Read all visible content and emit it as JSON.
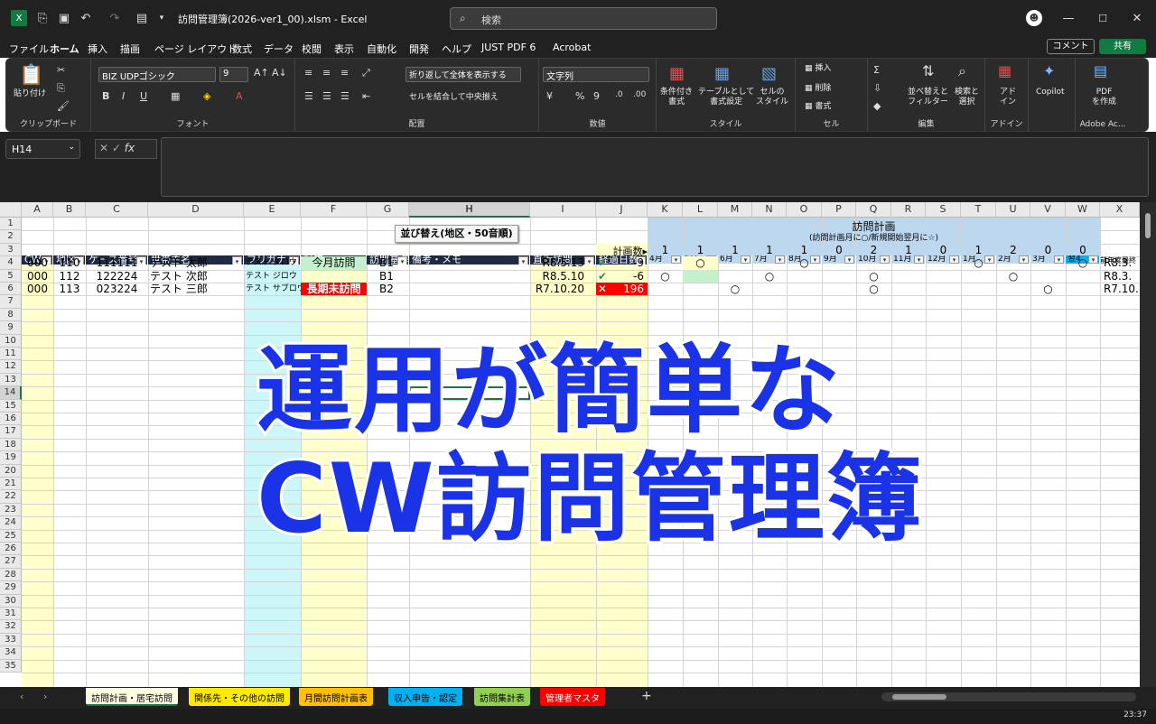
{
  "window": {
    "title": "訪問管理簿(2026-ver1_00).xlsm  -  Excel",
    "search_placeholder": "検索"
  },
  "menu": [
    "ファイル",
    "ホーム",
    "挿入",
    "描画",
    "ページ レイアウト",
    "数式",
    "データ",
    "校閲",
    "表示",
    "自動化",
    "開発",
    "ヘルプ",
    "JUST PDF 6",
    "Acrobat"
  ],
  "menu_active": "ホーム",
  "comment_label": "コメント",
  "share_label": "共有",
  "ribbon": {
    "clipboard": {
      "label": "クリップボード",
      "paste": "貼り付け"
    },
    "font": {
      "label": "フォント",
      "font_name": "BIZ UDPゴシック",
      "font_size": "9"
    },
    "alignment": {
      "label": "配置",
      "wrap": "折り返して全体を表示する",
      "merge": "セルを結合して中央揃え"
    },
    "number": {
      "label": "数値",
      "format": "文字列"
    },
    "styles": {
      "label": "スタイル",
      "cond": "条件付き\n書式",
      "table": "テーブルとして\n書式設定",
      "cell": "セルの\nスタイル"
    },
    "cells": {
      "label": "セル",
      "insert": "挿入",
      "delete": "削除",
      "format": "書式"
    },
    "editing": {
      "label": "編集",
      "sort": "並べ替えと\nフィルター",
      "find": "検索と\n選択"
    },
    "addins": {
      "label": "アドイン",
      "addin": "アド\nイン"
    },
    "copilot": "Copilot",
    "adobe": {
      "label": "Adobe Ac...",
      "pdf": "PDF\nを作成"
    }
  },
  "name_box": "H14",
  "columns": [
    "A",
    "B",
    "C",
    "D",
    "E",
    "F",
    "G",
    "H",
    "I",
    "J",
    "K",
    "L",
    "M",
    "N",
    "O",
    "P",
    "Q",
    "R",
    "S",
    "T",
    "U",
    "V",
    "W",
    "X"
  ],
  "sort_button": "並び替え(地区・50音順)",
  "plan_title": "訪問計画",
  "plan_subtitle": "(訪問計画月に○/新規開始翌月に☆)",
  "plan_count_label": "計画数▸",
  "plan_counts": [
    "1",
    "1",
    "1",
    "1",
    "1",
    "0",
    "2",
    "1",
    "0",
    "1",
    "2",
    "0",
    "0"
  ],
  "headers": [
    "CW",
    "地区",
    "ケース番号",
    "世帯主名",
    "フリガナ",
    "対応",
    "訪問基準",
    "備考・メモ",
    "直近訪問",
    "経過日数",
    "4月",
    "5月",
    "6月",
    "7月",
    "8月",
    "9月",
    "10月",
    "11月",
    "12月",
    "1月",
    "2月",
    "3月",
    "翌4",
    "前年度最終"
  ],
  "rows": [
    {
      "cw": "000",
      "area": "110",
      "case": "111111",
      "name": "テスト 太郎",
      "kana": "テスト タロウ",
      "status": "今月訪問",
      "base": "B1",
      "last": "R8.5.13",
      "mark": "✔",
      "days": "-9",
      "prev": "R8.3."
    },
    {
      "cw": "000",
      "area": "112",
      "case": "122224",
      "name": "テスト 次郎",
      "kana": "テスト ジロウ",
      "status": "",
      "base": "B1",
      "last": "R8.5.10",
      "mark": "✔",
      "days": "-6",
      "prev": "R8.3."
    },
    {
      "cw": "000",
      "area": "113",
      "case": "023224",
      "name": "テスト 三郎",
      "kana": "テスト サブロウ",
      "status": "長期未訪問",
      "base": "B2",
      "last": "R7.10.20",
      "mark": "✕",
      "days": "196",
      "prev": "R7.10."
    }
  ],
  "circle_symbol": "○",
  "row_numbers": [
    "1",
    "2",
    "3",
    "4",
    "5",
    "6",
    "7",
    "8",
    "9",
    "10",
    "11",
    "12",
    "13",
    "14",
    "15",
    "16",
    "17",
    "18",
    "19",
    "20",
    "21",
    "22",
    "23",
    "24",
    "25",
    "26",
    "27",
    "28",
    "29",
    "30",
    "31",
    "32",
    "33",
    "34",
    "35"
  ],
  "overlay": {
    "line1": "運用が簡単な",
    "line2": "CW訪問管理簿"
  },
  "sheet_tabs": [
    {
      "label": "訪問計画・居宅訪問",
      "color": "#fffde0",
      "active": true
    },
    {
      "label": "関係先・その他の訪問",
      "color": "#ffeb00"
    },
    {
      "label": "月間訪問計画表",
      "color": "#ffc000"
    },
    {
      "label": "収入申告・認定",
      "color": "#00b0f0"
    },
    {
      "label": "訪問集計表",
      "color": "#92d050"
    },
    {
      "label": "管理者マスタ",
      "color": "#ff0000"
    }
  ],
  "time": "23:37"
}
